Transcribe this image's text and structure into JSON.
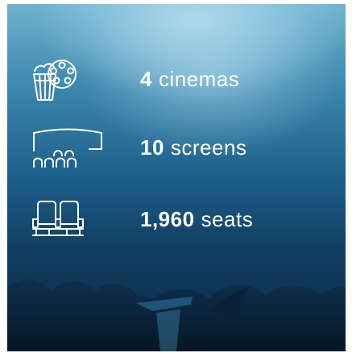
{
  "stats": [
    {
      "number": "4",
      "label": "cinemas",
      "icon": "film-reel-popcorn-icon"
    },
    {
      "number": "10",
      "label": "screens",
      "icon": "cinema-screen-seats-icon"
    },
    {
      "number": "1,960",
      "label": "seats",
      "icon": "theater-seats-icon"
    }
  ],
  "colors": {
    "text": "#ffffff",
    "background_top": "#6fb2cf",
    "background_bottom": "#0b2742"
  }
}
